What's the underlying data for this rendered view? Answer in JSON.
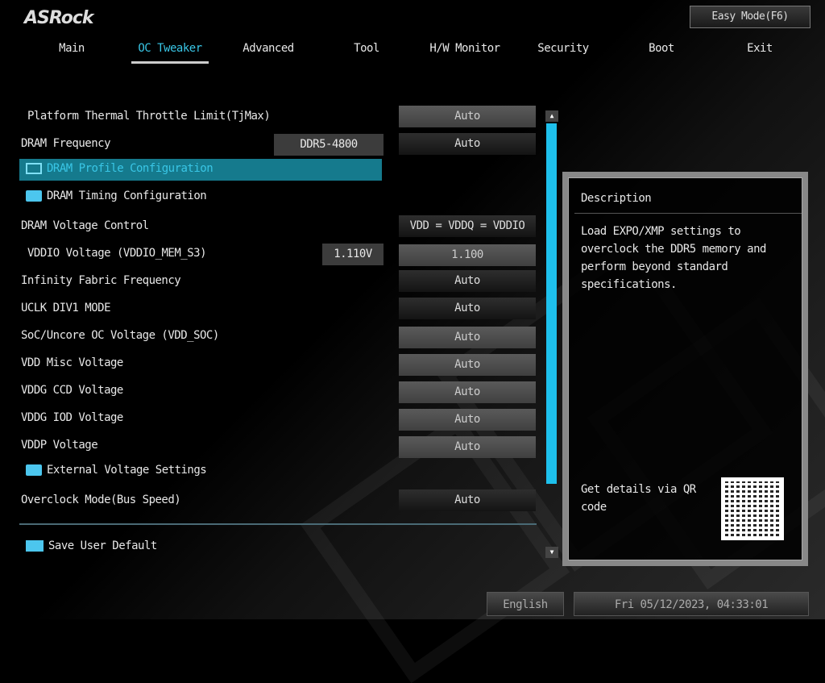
{
  "brand": "ASRock",
  "easy_mode": "Easy Mode(F6)",
  "tabs": [
    "Main",
    "OC Tweaker",
    "Advanced",
    "Tool",
    "H/W Monitor",
    "Security",
    "Boot",
    "Exit"
  ],
  "active_tab": "OC Tweaker",
  "settings": [
    {
      "label": "Platform Thermal Throttle Limit(TjMax)",
      "value": "Auto"
    },
    {
      "label": "DRAM Frequency",
      "current": "DDR5-4800",
      "value": "Auto"
    },
    {
      "label": "DRAM Profile Configuration"
    },
    {
      "label": "DRAM Timing Configuration"
    },
    {
      "label": "DRAM Voltage Control",
      "value": "VDD = VDDQ = VDDIO"
    },
    {
      "label": "VDDIO Voltage (VDDIO_MEM_S3)",
      "current": "1.110V",
      "value": "1.100"
    },
    {
      "label": "Infinity Fabric Frequency",
      "value": "Auto"
    },
    {
      "label": "UCLK DIV1 MODE",
      "value": "Auto"
    },
    {
      "label": "SoC/Uncore OC Voltage (VDD_SOC)",
      "value": "Auto"
    },
    {
      "label": "VDD Misc Voltage",
      "value": "Auto"
    },
    {
      "label": "VDDG CCD Voltage",
      "value": "Auto"
    },
    {
      "label": "VDDG IOD Voltage",
      "value": "Auto"
    },
    {
      "label": "VDDP Voltage",
      "value": "Auto"
    },
    {
      "label": "External Voltage Settings"
    },
    {
      "label": "Overclock Mode(Bus Speed)",
      "value": "Auto"
    },
    {
      "label": "Save User Default"
    }
  ],
  "description": {
    "title": "Description",
    "text": "Load EXPO/XMP settings to overclock the DDR5 memory and perform beyond standard specifications.",
    "qr_text": "Get details via QR code"
  },
  "language": "English",
  "datetime": "Fri 05/12/2023, 04:33:01",
  "colors": {
    "accent": "#39c6e6",
    "selection": "#157a8d",
    "scrollbar": "#1ec0ec"
  }
}
